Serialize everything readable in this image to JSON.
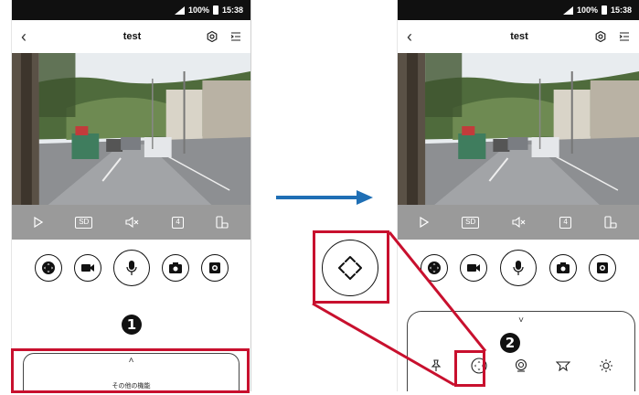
{
  "status_bar": {
    "battery": "100%",
    "time": "15:38"
  },
  "header": {
    "title": "test"
  },
  "control_bar": {
    "quality_label": "SD",
    "split_count": "4"
  },
  "left_panel": {
    "step_number": "1",
    "drawer_label": "その他の機能"
  },
  "right_panel": {
    "step_number": "2"
  },
  "colors": {
    "highlight_red": "#c8102e",
    "arrow_blue": "#1f6fb5",
    "control_bar_gray": "#9a9a9a"
  },
  "icons": {
    "header": [
      "back-arrow-icon",
      "settings-icon",
      "menu-icon"
    ],
    "control_bar": [
      "play-icon",
      "sd-quality-icon",
      "mute-icon",
      "split-view-icon",
      "rotate-phone-icon"
    ],
    "action_row": [
      "ptz-control-icon",
      "record-video-icon",
      "microphone-icon",
      "snapshot-icon",
      "screenshot-icon"
    ],
    "drawer_row": [
      "pin-icon",
      "ptz-control-icon",
      "face-detect-icon",
      "cruise-icon",
      "light-icon"
    ]
  }
}
